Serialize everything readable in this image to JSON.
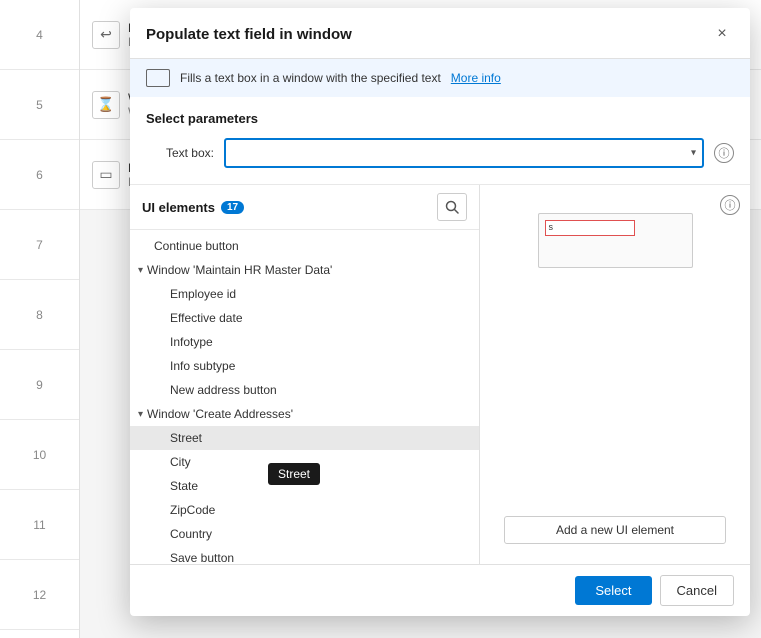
{
  "background": {
    "rows": [
      {
        "number": "4",
        "icon": "↩",
        "label": "Pre",
        "sublabel": "Pres"
      },
      {
        "number": "5",
        "icon": "⌛",
        "label": "Wai",
        "sublabel": "Wai"
      },
      {
        "number": "6",
        "icon": "▭",
        "label": "Pop",
        "sublabel": "Pop"
      }
    ]
  },
  "dialog": {
    "title": "Populate text field in window",
    "close_label": "×",
    "info_bar": {
      "text": "Fills a text box in a window with the specified text",
      "link_label": "More info"
    },
    "params_section": {
      "title": "Select parameters",
      "text_box_label": "Text box:",
      "text_box_placeholder": "",
      "info_button_label": "ⓘ"
    },
    "ui_elements": {
      "title": "UI elements",
      "badge": "17",
      "search_button_label": "🔍",
      "items": [
        {
          "id": "continue-button",
          "label": "Continue button",
          "level": 1,
          "type": "leaf"
        },
        {
          "id": "window-hr",
          "label": "Window 'Maintain HR Master Data'",
          "level": 0,
          "type": "group",
          "expanded": true
        },
        {
          "id": "employee-id",
          "label": "Employee id",
          "level": 2,
          "type": "leaf"
        },
        {
          "id": "effective-date",
          "label": "Effective date",
          "level": 2,
          "type": "leaf"
        },
        {
          "id": "infotype",
          "label": "Infotype",
          "level": 2,
          "type": "leaf"
        },
        {
          "id": "info-subtype",
          "label": "Info subtype",
          "level": 2,
          "type": "leaf"
        },
        {
          "id": "new-address-button",
          "label": "New address button",
          "level": 2,
          "type": "leaf"
        },
        {
          "id": "window-create",
          "label": "Window 'Create Addresses'",
          "level": 0,
          "type": "group",
          "expanded": true
        },
        {
          "id": "street",
          "label": "Street",
          "level": 2,
          "type": "leaf",
          "selected": true
        },
        {
          "id": "city",
          "label": "City",
          "level": 2,
          "type": "leaf"
        },
        {
          "id": "state",
          "label": "State",
          "level": 2,
          "type": "leaf"
        },
        {
          "id": "zipcode",
          "label": "ZipCode",
          "level": 2,
          "type": "leaf"
        },
        {
          "id": "country",
          "label": "Country",
          "level": 2,
          "type": "leaf"
        },
        {
          "id": "save-button",
          "label": "Save button",
          "level": 2,
          "type": "leaf"
        }
      ],
      "add_button_label": "Add a new UI element"
    },
    "tooltip": {
      "text": "Street"
    },
    "footer": {
      "select_label": "Select",
      "cancel_label": "Cancel"
    }
  }
}
